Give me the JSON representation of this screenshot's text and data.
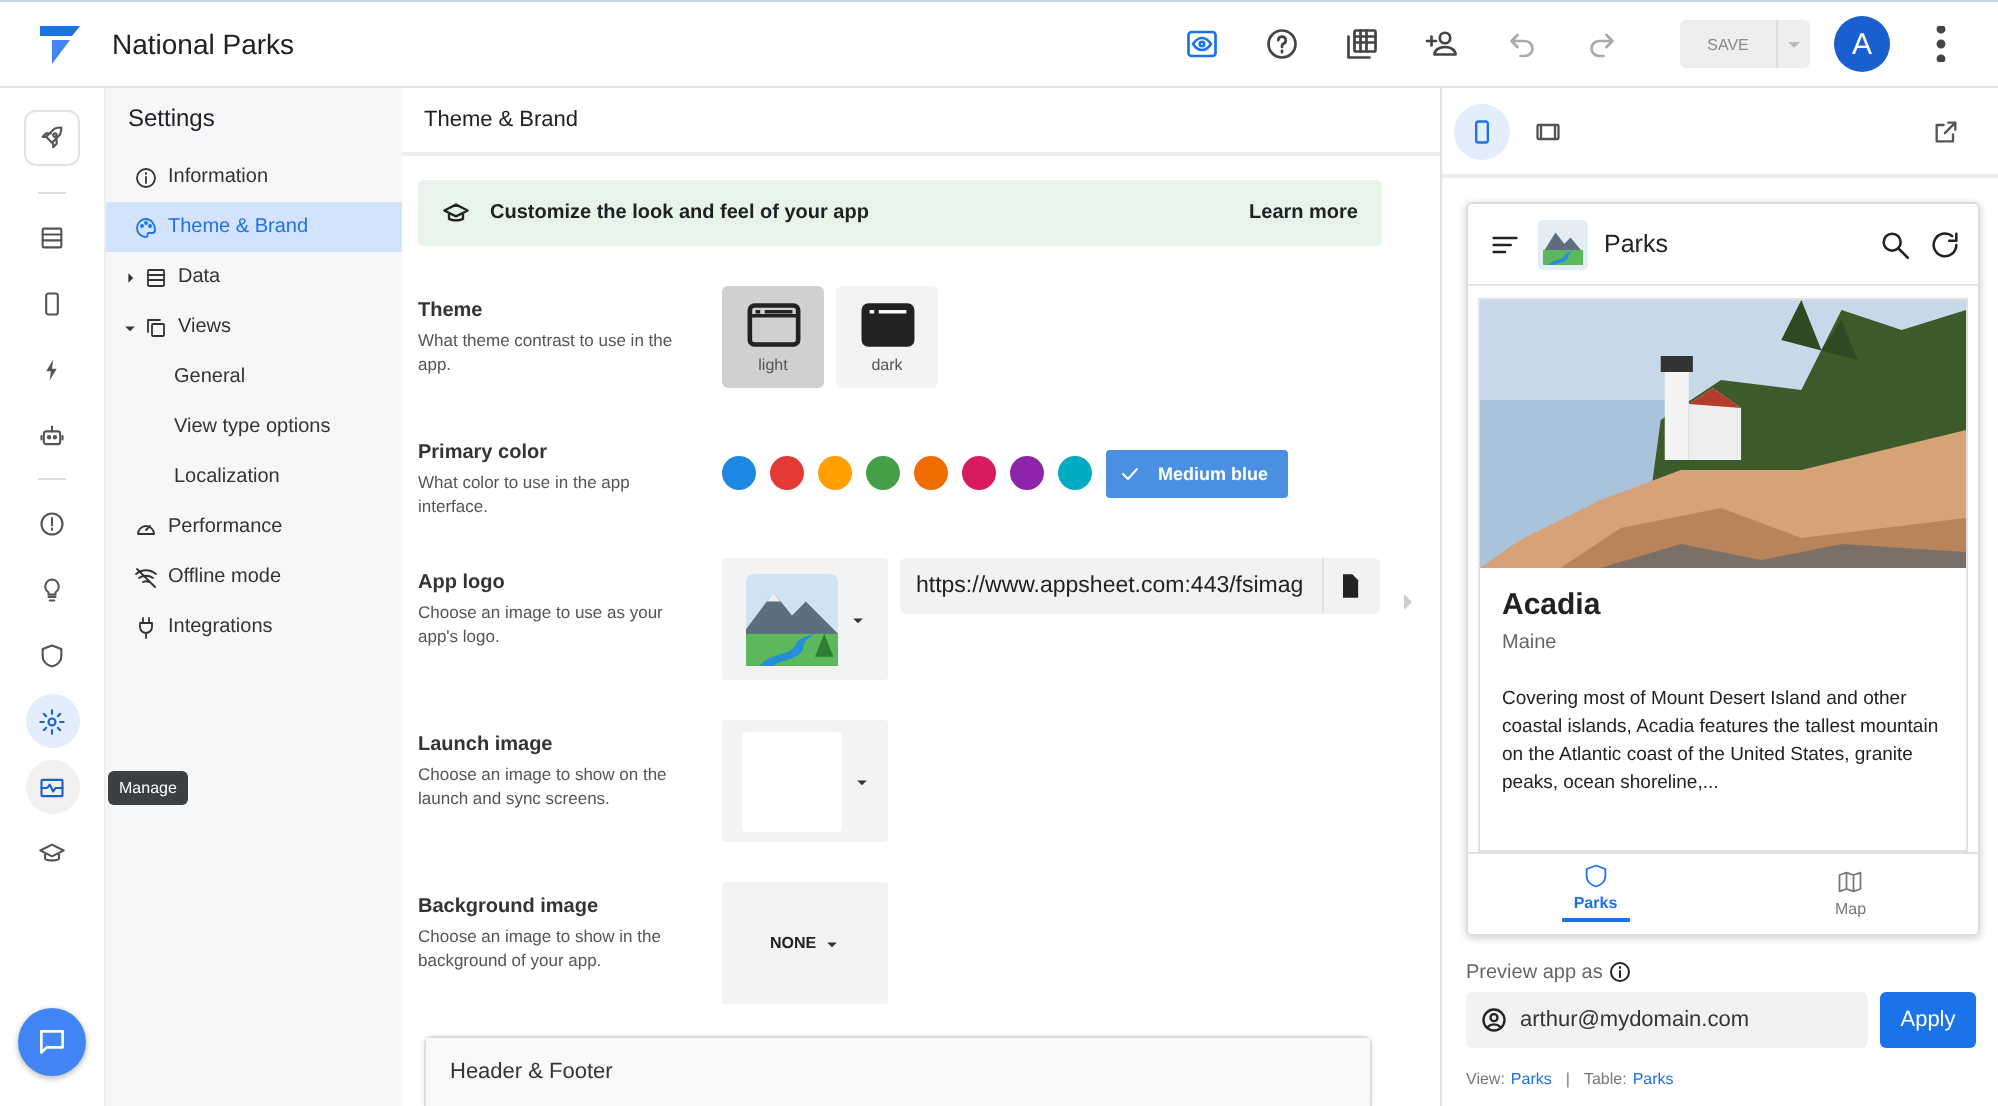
{
  "app": {
    "title": "National Parks"
  },
  "toolbar": [
    {
      "kind": "preview",
      "selected": true,
      "disabled": false
    },
    {
      "kind": "help",
      "selected": false,
      "disabled": false
    },
    {
      "kind": "grid",
      "selected": false,
      "disabled": false
    },
    {
      "kind": "addperson",
      "selected": false,
      "disabled": false
    },
    {
      "kind": "undo",
      "selected": false,
      "disabled": true
    },
    {
      "kind": "redo",
      "selected": false,
      "disabled": true
    }
  ],
  "save_button": {
    "label": "SAVE",
    "disabled": true
  },
  "avatar": {
    "letter": "A"
  },
  "rail": {
    "tooltip": "Manage",
    "groups": [
      {
        "items": [
          {
            "kind": "rocket",
            "selected": false,
            "hovered": false
          }
        ]
      },
      {
        "items": [
          {
            "kind": "table",
            "selected": false,
            "hovered": false
          },
          {
            "kind": "phone",
            "selected": false,
            "hovered": false
          },
          {
            "kind": "bolt",
            "selected": false,
            "hovered": false
          },
          {
            "kind": "robot",
            "selected": false,
            "hovered": false
          }
        ]
      },
      {
        "items": [
          {
            "kind": "alert",
            "selected": false,
            "hovered": false
          },
          {
            "kind": "bulb",
            "selected": false,
            "hovered": false
          },
          {
            "kind": "shield",
            "selected": false,
            "hovered": false
          },
          {
            "kind": "gear",
            "selected": true,
            "hovered": false
          },
          {
            "kind": "monitor",
            "selected": false,
            "hovered": true
          },
          {
            "kind": "school",
            "selected": false,
            "hovered": false
          }
        ]
      }
    ]
  },
  "settings": {
    "title": "Settings",
    "items": [
      {
        "label": "Information",
        "kind": "info",
        "selected": false
      },
      {
        "label": "Theme & Brand",
        "kind": "palette",
        "selected": true
      },
      {
        "label": "Data",
        "kind": "table",
        "selected": false,
        "expanded": false
      },
      {
        "label": "Views",
        "kind": "copy",
        "selected": false,
        "expanded": true,
        "children": [
          {
            "label": "General",
            "selected": false
          },
          {
            "label": "View type options",
            "selected": false
          },
          {
            "label": "Localization",
            "selected": false
          }
        ]
      },
      {
        "label": "Performance",
        "kind": "speed",
        "selected": false
      },
      {
        "label": "Offline mode",
        "kind": "offline",
        "selected": false
      },
      {
        "label": "Integrations",
        "kind": "plug",
        "selected": false
      }
    ]
  },
  "main": {
    "title": "Theme & Brand",
    "banner": {
      "text": "Customize the look and feel of your app",
      "link": "Learn more"
    },
    "theme": {
      "label": "Theme",
      "hint": "What theme contrast to use in the app.",
      "options": [
        {
          "label": "light",
          "kind": "light",
          "selected": true
        },
        {
          "label": "dark",
          "kind": "dark",
          "selected": false
        }
      ]
    },
    "primary_color": {
      "label": "Primary color",
      "hint": "What color to use in the app interface.",
      "swatches": [
        {
          "color": "#1e88e5"
        },
        {
          "color": "#e53935"
        },
        {
          "color": "#ffa000"
        },
        {
          "color": "#43a047"
        },
        {
          "color": "#ef6c00"
        },
        {
          "color": "#d81b60"
        },
        {
          "color": "#8e24aa"
        },
        {
          "color": "#00acc1"
        }
      ],
      "chosen": "Medium blue"
    },
    "app_logo": {
      "label": "App logo",
      "hint": "Choose an image to use as your app's logo.",
      "url": "https://www.appsheet.com:443/fsimag"
    },
    "launch_image": {
      "label": "Launch image",
      "hint": "Choose an image to show on the launch and sync screens."
    },
    "background_image": {
      "label": "Background image",
      "hint": "Choose an image to show in the background of your app.",
      "value": "NONE"
    },
    "header_footer": {
      "title": "Header & Footer"
    }
  },
  "preview": {
    "devices": [
      {
        "kind": "phone",
        "selected": true
      },
      {
        "kind": "tablet",
        "selected": false
      }
    ],
    "app_header": {
      "title": "Parks"
    },
    "card": {
      "title": "Acadia",
      "subtitle": "Maine",
      "description": "Covering most of Mount Desert Island and other coastal islands, Acadia features the tallest mountain on the Atlantic coast of the United States, granite peaks, ocean shoreline,..."
    },
    "nav": [
      {
        "label": "Parks",
        "kind": "shield",
        "selected": true
      },
      {
        "label": "Map",
        "kind": "map",
        "selected": false
      }
    ],
    "preview_as": {
      "label": "Preview app as",
      "email": "arthur@mydomain.com",
      "button": "Apply"
    },
    "footer": {
      "view_label": "View:",
      "view": "Parks",
      "separator": "|",
      "table_label": "Table:",
      "table": "Parks"
    }
  }
}
